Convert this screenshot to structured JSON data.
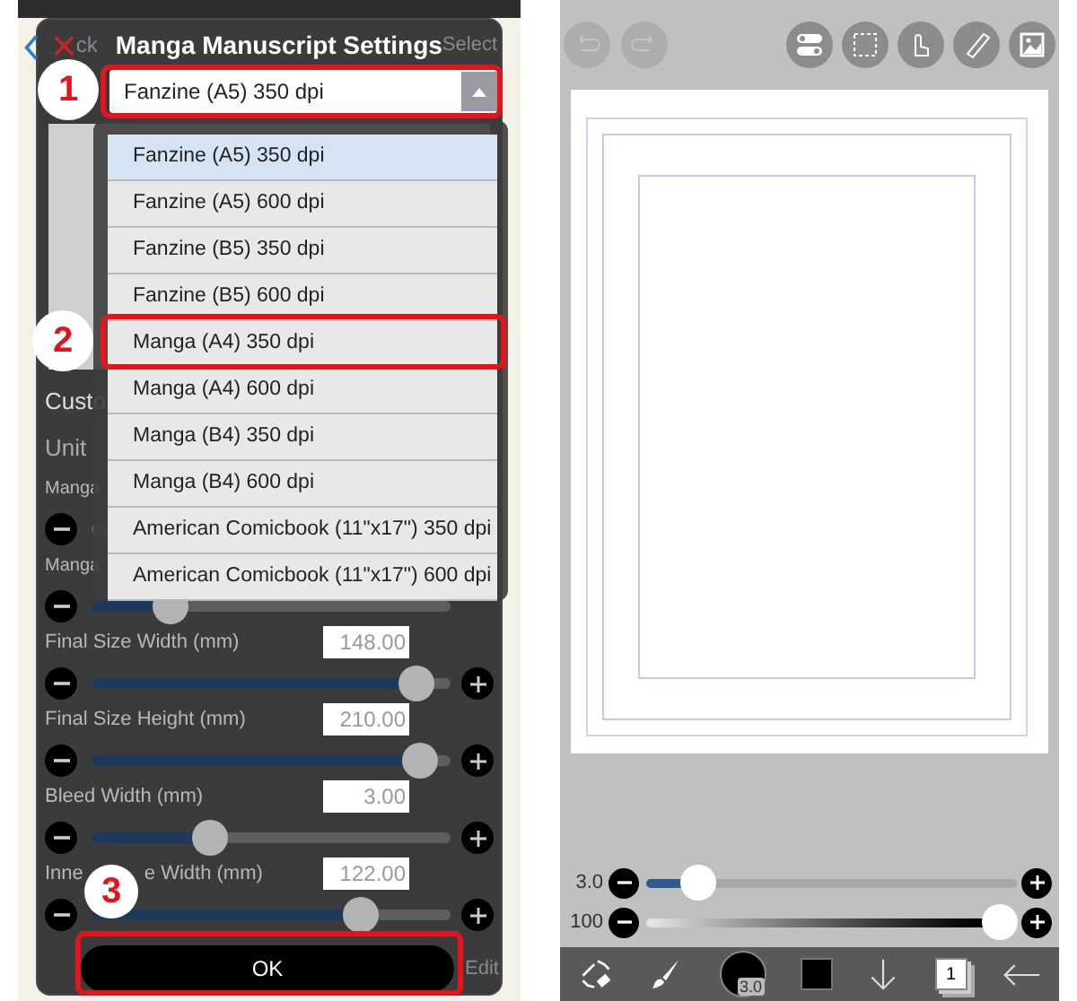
{
  "settings_screen": {
    "back_fragment": "ck",
    "title": "Manga Manuscript Settings",
    "select_action": "Select",
    "preset_select": {
      "value": "Fanzine (A5) 350 dpi"
    },
    "preset_options": [
      {
        "label": "Fanzine (A5) 350 dpi",
        "selected": true
      },
      {
        "label": "Fanzine (A5) 600 dpi",
        "selected": false
      },
      {
        "label": "Fanzine (B5) 350 dpi",
        "selected": false
      },
      {
        "label": "Fanzine (B5) 600 dpi",
        "selected": false
      },
      {
        "label": "Manga (A4) 350 dpi",
        "selected": false
      },
      {
        "label": "Manga (A4) 600 dpi",
        "selected": false
      },
      {
        "label": "Manga (B4) 350 dpi",
        "selected": false
      },
      {
        "label": "Manga (B4) 600 dpi",
        "selected": false
      },
      {
        "label": "American Comicbook (11\"x17\") 350 dpi",
        "selected": false
      },
      {
        "label": "American Comicbook (11\"x17\") 600 dpi",
        "selected": false
      }
    ],
    "section_heading": "Custo",
    "unit_label": "Unit",
    "fields": [
      {
        "label": "Manga"
      },
      {
        "label": "Manga",
        "level": 0.19
      },
      {
        "label": "Final Size Width (mm)",
        "value": "148.00",
        "level": 0.95
      },
      {
        "label": "Final Size Height (mm)",
        "value": "210.00",
        "level": 0.96
      },
      {
        "label": "Bleed Width (mm)",
        "value": "3.00",
        "level": 0.31
      },
      {
        "label": "Inne",
        "label_tail": "e Width (mm)",
        "value": "122.00",
        "level": 0.78
      }
    ],
    "ok_button": "OK",
    "edit_action": "Edit",
    "callouts": [
      "1",
      "2",
      "3"
    ]
  },
  "canvas_screen": {
    "size_reading": "3.0",
    "size_slider": {
      "level": 0.1
    },
    "opacity_reading": "100",
    "opacity_slider": {
      "level": 1
    },
    "brush_size_badge": "3.0",
    "layer_count": "1"
  }
}
